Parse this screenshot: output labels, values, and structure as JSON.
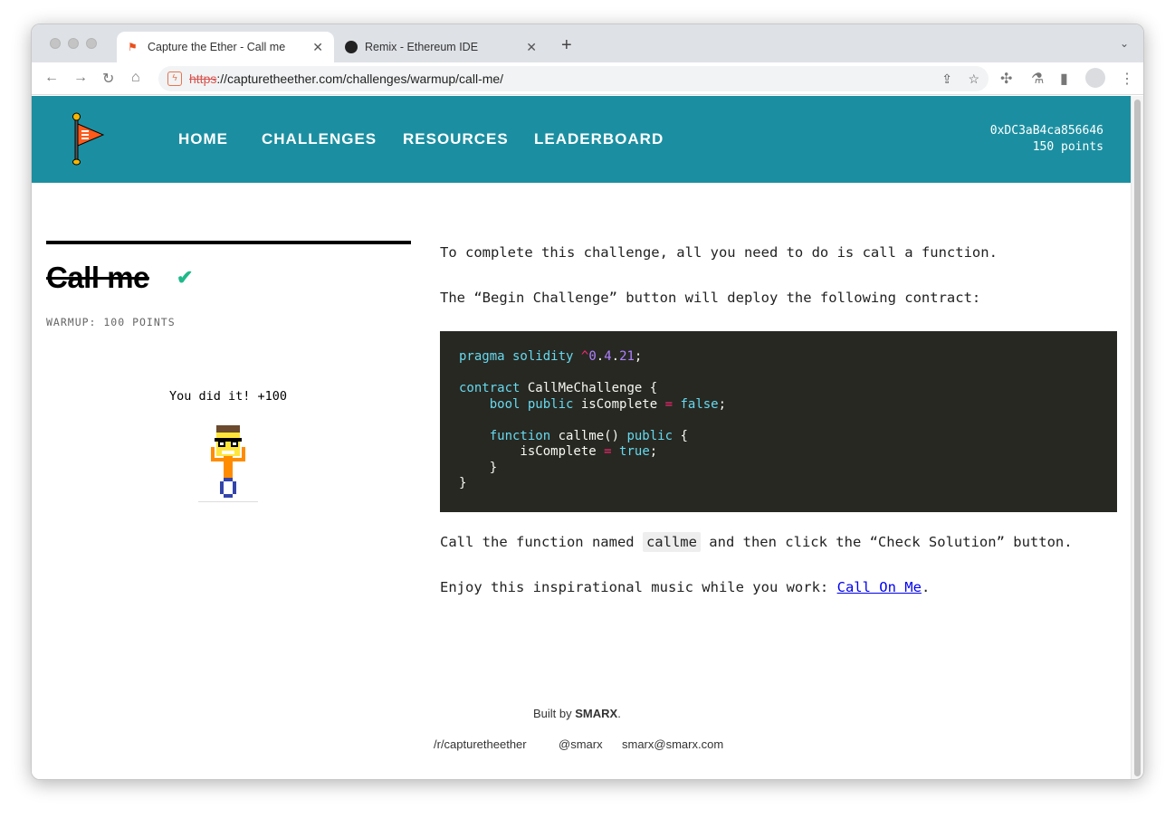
{
  "browser": {
    "tabs": [
      {
        "title": "Capture the Ether - Call me",
        "icon": "flag-icon"
      },
      {
        "title": "Remix - Ethereum IDE",
        "icon": "remix-icon"
      }
    ],
    "url_scheme": "https",
    "url_rest": "://capturetheether.com/challenges/warmup/call-me/"
  },
  "nav": {
    "items": [
      "HOME",
      "CHALLENGES",
      "RESOURCES",
      "LEADERBOARD"
    ]
  },
  "account": {
    "address": "0xDC3aB4ca856646",
    "points": "150 points"
  },
  "challenge": {
    "title": "Call me",
    "category": "WARMUP: 100 POINTS",
    "result": "You did it! +100"
  },
  "content": {
    "p1": "To complete this challenge, all you need to do is call a function.",
    "p2": "The “Begin Challenge” button will deploy the following contract:",
    "p3_pre": "Call the function named ",
    "p3_code": "callme",
    "p3_post": " and then click the “Check Solution” button.",
    "p4_pre": "Enjoy this inspirational music while you work: ",
    "p4_link": "Call On Me",
    "p4_post": "."
  },
  "footer": {
    "built_by": "Built by ",
    "author": "SMARX",
    "period": ".",
    "links": [
      "/r/capturetheether",
      "@smarx",
      "smarx@smarx.com"
    ]
  },
  "colors": {
    "header": "#1b8fa1",
    "code_bg": "#272822",
    "check": "#20b98a"
  }
}
